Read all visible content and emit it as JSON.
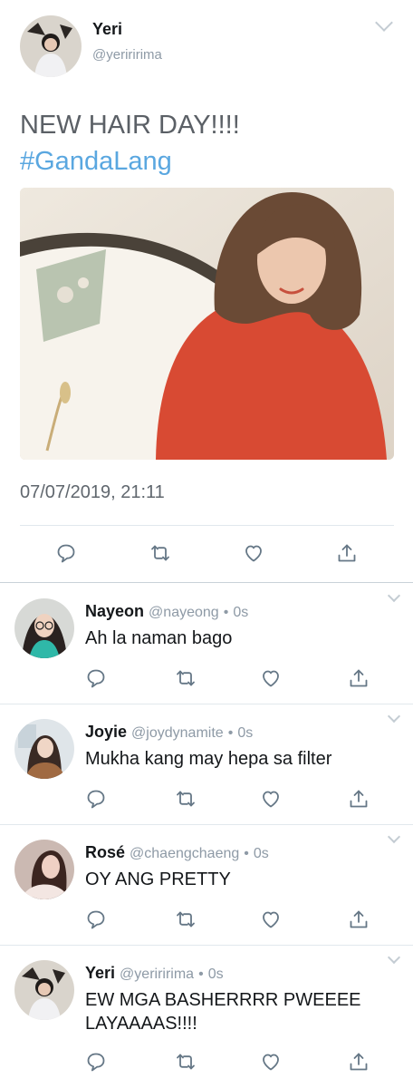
{
  "main_tweet": {
    "author_name": "Yeri",
    "author_handle": "@yeriririma",
    "text": "NEW HAIR DAY!!!!",
    "hashtag": "#GandaLang",
    "timestamp": "07/07/2019, 21:11",
    "actions": [
      "reply-icon",
      "retweet-icon",
      "like-icon",
      "share-icon"
    ]
  },
  "replies": [
    {
      "name": "Nayeon",
      "handle": "@nayeong",
      "time": "0s",
      "text": "Ah la naman bago"
    },
    {
      "name": "Joyie",
      "handle": "@joydynamite",
      "time": "0s",
      "text": "Mukha kang may hepa sa filter"
    },
    {
      "name": "Rosé",
      "handle": "@chaengchaeng",
      "time": "0s",
      "text": "OY ANG PRETTY"
    },
    {
      "name": "Yeri",
      "handle": "@yeriririma",
      "time": "0s",
      "text": "EW MGA BASHERRRR PWEEEE LAYAAAAS!!!!"
    }
  ],
  "separator": "•",
  "colors": {
    "link": "#5aa7e0",
    "muted": "#8e9aa6",
    "icon": "#657786"
  }
}
